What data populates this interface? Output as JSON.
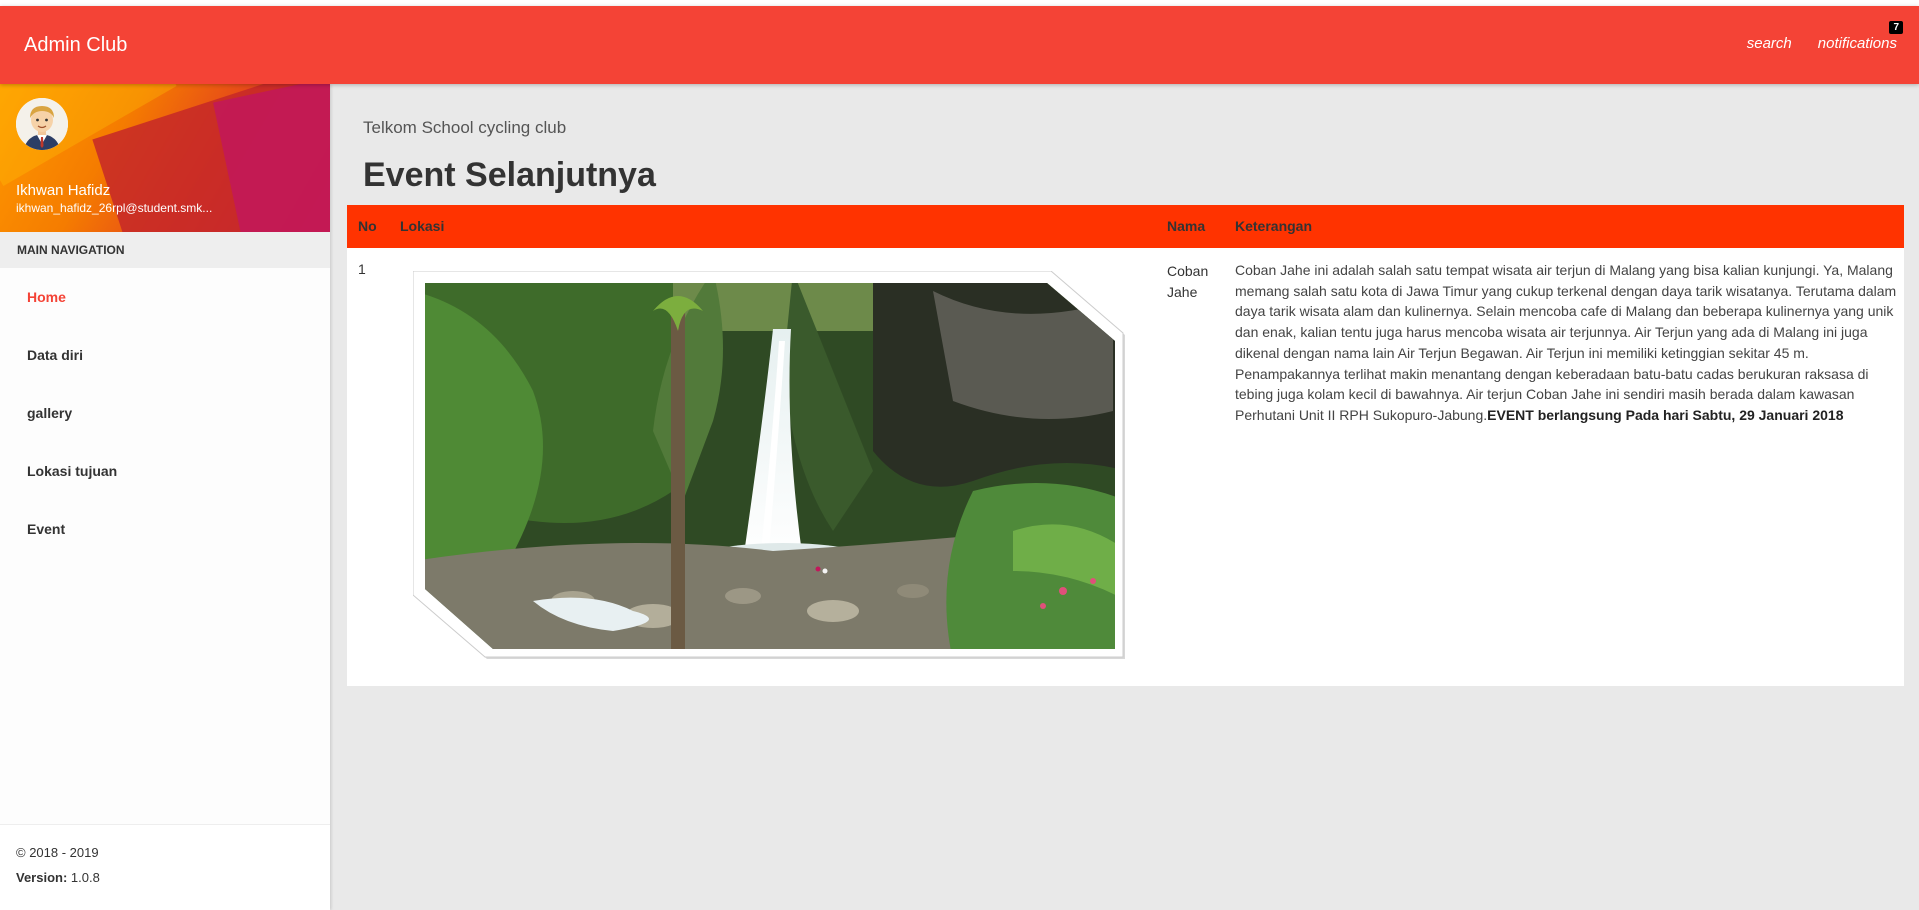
{
  "navbar": {
    "brand": "Admin Club",
    "search_label": "search",
    "notifications_label": "notifications",
    "notifications_count": "7",
    "color": "#f44336"
  },
  "sidebar": {
    "user": {
      "name": "Ikhwan Hafidz",
      "email": "ikhwan_hafidz_26rpl@student.smk..."
    },
    "nav_header": "MAIN NAVIGATION",
    "items": [
      {
        "label": "Home",
        "active": true
      },
      {
        "label": "Data diri",
        "active": false
      },
      {
        "label": "gallery",
        "active": false
      },
      {
        "label": "Lokasi tujuan",
        "active": false
      },
      {
        "label": "Event",
        "active": false
      }
    ],
    "footer": {
      "copyright": "© 2018 - 2019",
      "version_label": "Version:",
      "version_value": "1.0.8"
    }
  },
  "main": {
    "subtitle": "Telkom School cycling club",
    "title": "Event Selanjutnya",
    "table": {
      "header_color": "#ff3300",
      "columns": [
        "No",
        "Lokasi",
        "Nama",
        "Keterangan"
      ],
      "rows": [
        {
          "no": "1",
          "lokasi_image": "waterfall-photo",
          "nama": "Coban Jahe",
          "keterangan": "Coban Jahe ini adalah salah satu tempat wisata air terjun di Malang yang bisa kalian kunjungi. Ya, Malang memang salah satu kota di Jawa Timur yang cukup terkenal dengan daya tarik wisatanya. Terutama dalam daya tarik wisata alam dan kulinernya. Selain mencoba cafe di Malang dan beberapa kulinernya yang unik dan enak, kalian tentu juga harus mencoba wisata air terjunnya. Air Terjun yang ada di Malang ini juga dikenal dengan nama lain Air Terjun Begawan. Air Terjun ini memiliki ketinggian sekitar 45 m. Penampakannya terlihat makin menantang dengan keberadaan batu-batu cadas berukuran raksasa di tebing juga kolam kecil di bawahnya. Air terjun Coban Jahe ini sendiri masih berada dalam kawasan Perhutani Unit II RPH Sukopuro-Jabung.",
          "keterangan_bold": "EVENT berlangsung Pada hari Sabtu, 29 Januari 2018"
        }
      ]
    }
  }
}
